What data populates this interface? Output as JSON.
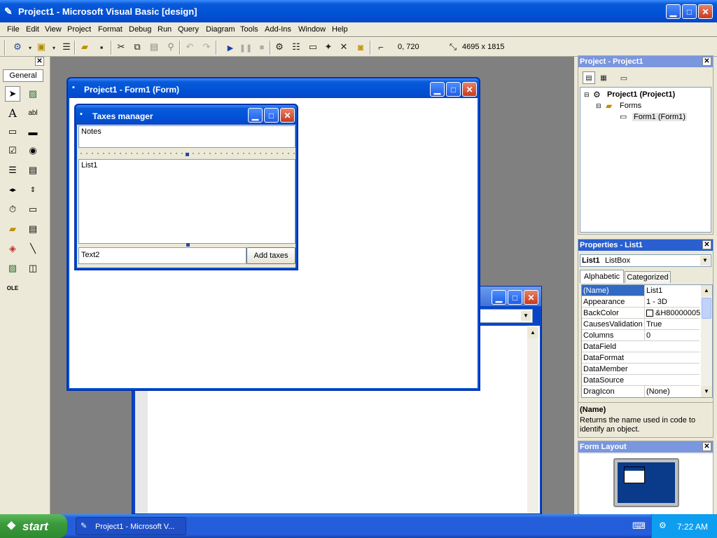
{
  "window": {
    "title": "Project1 - Microsoft Visual Basic [design]"
  },
  "menu": [
    "File",
    "Edit",
    "View",
    "Project",
    "Format",
    "Debug",
    "Run",
    "Query",
    "Diagram",
    "Tools",
    "Add-Ins",
    "Window",
    "Help"
  ],
  "toolbar": {
    "position": "0, 720",
    "size": "4695 x 1815"
  },
  "toolbox": {
    "title": "General"
  },
  "form_designer": {
    "title": "Project1 - Form1 (Form)"
  },
  "taxes_form": {
    "title": "Taxes manager",
    "notes_text": "Notes",
    "list_text": "List1",
    "text2": "Text2",
    "add_button": "Add taxes"
  },
  "project_panel": {
    "title": "Project - Project1",
    "tree": {
      "root": "Project1 (Project1)",
      "folder": "Forms",
      "item": "Form1 (Form1)"
    }
  },
  "properties_panel": {
    "title": "Properties - List1",
    "object_name": "List1",
    "object_type": "ListBox",
    "tabs": [
      "Alphabetic",
      "Categorized"
    ],
    "rows": [
      {
        "k": "(Name)",
        "v": "List1"
      },
      {
        "k": "Appearance",
        "v": "1 - 3D"
      },
      {
        "k": "BackColor",
        "v": "&H80000005"
      },
      {
        "k": "CausesValidation",
        "v": "True"
      },
      {
        "k": "Columns",
        "v": "0"
      },
      {
        "k": "DataField",
        "v": ""
      },
      {
        "k": "DataFormat",
        "v": ""
      },
      {
        "k": "DataMember",
        "v": ""
      },
      {
        "k": "DataSource",
        "v": ""
      },
      {
        "k": "DragIcon",
        "v": "(None)"
      }
    ],
    "desc_title": "(Name)",
    "desc_text": "Returns the name used in code to identify an object."
  },
  "form_layout": {
    "title": "Form Layout"
  },
  "taskbar": {
    "start": "start",
    "task": "Project1 - Microsoft V...",
    "clock": "7:22 AM"
  },
  "colors": {
    "xp_blue": "#0052d6",
    "taskbar": "#245edb",
    "start_green": "#3c9a3c",
    "desktop_grey": "#808080"
  }
}
